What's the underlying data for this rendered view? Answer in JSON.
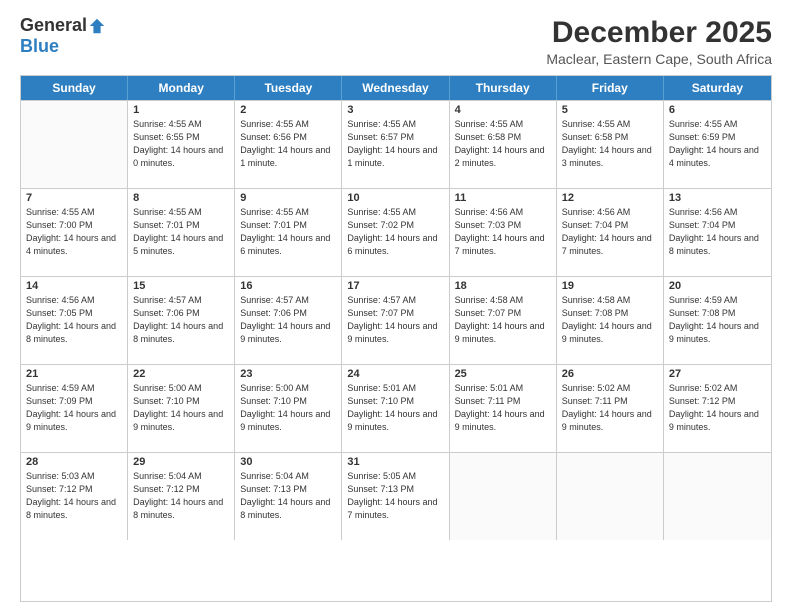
{
  "logo": {
    "general": "General",
    "blue": "Blue"
  },
  "header": {
    "title": "December 2025",
    "subtitle": "Maclear, Eastern Cape, South Africa"
  },
  "weekdays": [
    "Sunday",
    "Monday",
    "Tuesday",
    "Wednesday",
    "Thursday",
    "Friday",
    "Saturday"
  ],
  "weeks": [
    [
      {
        "day": "",
        "sunrise": "",
        "sunset": "",
        "daylight": ""
      },
      {
        "day": "1",
        "sunrise": "Sunrise: 4:55 AM",
        "sunset": "Sunset: 6:55 PM",
        "daylight": "Daylight: 14 hours and 0 minutes."
      },
      {
        "day": "2",
        "sunrise": "Sunrise: 4:55 AM",
        "sunset": "Sunset: 6:56 PM",
        "daylight": "Daylight: 14 hours and 1 minute."
      },
      {
        "day": "3",
        "sunrise": "Sunrise: 4:55 AM",
        "sunset": "Sunset: 6:57 PM",
        "daylight": "Daylight: 14 hours and 1 minute."
      },
      {
        "day": "4",
        "sunrise": "Sunrise: 4:55 AM",
        "sunset": "Sunset: 6:58 PM",
        "daylight": "Daylight: 14 hours and 2 minutes."
      },
      {
        "day": "5",
        "sunrise": "Sunrise: 4:55 AM",
        "sunset": "Sunset: 6:58 PM",
        "daylight": "Daylight: 14 hours and 3 minutes."
      },
      {
        "day": "6",
        "sunrise": "Sunrise: 4:55 AM",
        "sunset": "Sunset: 6:59 PM",
        "daylight": "Daylight: 14 hours and 4 minutes."
      }
    ],
    [
      {
        "day": "7",
        "sunrise": "Sunrise: 4:55 AM",
        "sunset": "Sunset: 7:00 PM",
        "daylight": "Daylight: 14 hours and 4 minutes."
      },
      {
        "day": "8",
        "sunrise": "Sunrise: 4:55 AM",
        "sunset": "Sunset: 7:01 PM",
        "daylight": "Daylight: 14 hours and 5 minutes."
      },
      {
        "day": "9",
        "sunrise": "Sunrise: 4:55 AM",
        "sunset": "Sunset: 7:01 PM",
        "daylight": "Daylight: 14 hours and 6 minutes."
      },
      {
        "day": "10",
        "sunrise": "Sunrise: 4:55 AM",
        "sunset": "Sunset: 7:02 PM",
        "daylight": "Daylight: 14 hours and 6 minutes."
      },
      {
        "day": "11",
        "sunrise": "Sunrise: 4:56 AM",
        "sunset": "Sunset: 7:03 PM",
        "daylight": "Daylight: 14 hours and 7 minutes."
      },
      {
        "day": "12",
        "sunrise": "Sunrise: 4:56 AM",
        "sunset": "Sunset: 7:04 PM",
        "daylight": "Daylight: 14 hours and 7 minutes."
      },
      {
        "day": "13",
        "sunrise": "Sunrise: 4:56 AM",
        "sunset": "Sunset: 7:04 PM",
        "daylight": "Daylight: 14 hours and 8 minutes."
      }
    ],
    [
      {
        "day": "14",
        "sunrise": "Sunrise: 4:56 AM",
        "sunset": "Sunset: 7:05 PM",
        "daylight": "Daylight: 14 hours and 8 minutes."
      },
      {
        "day": "15",
        "sunrise": "Sunrise: 4:57 AM",
        "sunset": "Sunset: 7:06 PM",
        "daylight": "Daylight: 14 hours and 8 minutes."
      },
      {
        "day": "16",
        "sunrise": "Sunrise: 4:57 AM",
        "sunset": "Sunset: 7:06 PM",
        "daylight": "Daylight: 14 hours and 9 minutes."
      },
      {
        "day": "17",
        "sunrise": "Sunrise: 4:57 AM",
        "sunset": "Sunset: 7:07 PM",
        "daylight": "Daylight: 14 hours and 9 minutes."
      },
      {
        "day": "18",
        "sunrise": "Sunrise: 4:58 AM",
        "sunset": "Sunset: 7:07 PM",
        "daylight": "Daylight: 14 hours and 9 minutes."
      },
      {
        "day": "19",
        "sunrise": "Sunrise: 4:58 AM",
        "sunset": "Sunset: 7:08 PM",
        "daylight": "Daylight: 14 hours and 9 minutes."
      },
      {
        "day": "20",
        "sunrise": "Sunrise: 4:59 AM",
        "sunset": "Sunset: 7:08 PM",
        "daylight": "Daylight: 14 hours and 9 minutes."
      }
    ],
    [
      {
        "day": "21",
        "sunrise": "Sunrise: 4:59 AM",
        "sunset": "Sunset: 7:09 PM",
        "daylight": "Daylight: 14 hours and 9 minutes."
      },
      {
        "day": "22",
        "sunrise": "Sunrise: 5:00 AM",
        "sunset": "Sunset: 7:10 PM",
        "daylight": "Daylight: 14 hours and 9 minutes."
      },
      {
        "day": "23",
        "sunrise": "Sunrise: 5:00 AM",
        "sunset": "Sunset: 7:10 PM",
        "daylight": "Daylight: 14 hours and 9 minutes."
      },
      {
        "day": "24",
        "sunrise": "Sunrise: 5:01 AM",
        "sunset": "Sunset: 7:10 PM",
        "daylight": "Daylight: 14 hours and 9 minutes."
      },
      {
        "day": "25",
        "sunrise": "Sunrise: 5:01 AM",
        "sunset": "Sunset: 7:11 PM",
        "daylight": "Daylight: 14 hours and 9 minutes."
      },
      {
        "day": "26",
        "sunrise": "Sunrise: 5:02 AM",
        "sunset": "Sunset: 7:11 PM",
        "daylight": "Daylight: 14 hours and 9 minutes."
      },
      {
        "day": "27",
        "sunrise": "Sunrise: 5:02 AM",
        "sunset": "Sunset: 7:12 PM",
        "daylight": "Daylight: 14 hours and 9 minutes."
      }
    ],
    [
      {
        "day": "28",
        "sunrise": "Sunrise: 5:03 AM",
        "sunset": "Sunset: 7:12 PM",
        "daylight": "Daylight: 14 hours and 8 minutes."
      },
      {
        "day": "29",
        "sunrise": "Sunrise: 5:04 AM",
        "sunset": "Sunset: 7:12 PM",
        "daylight": "Daylight: 14 hours and 8 minutes."
      },
      {
        "day": "30",
        "sunrise": "Sunrise: 5:04 AM",
        "sunset": "Sunset: 7:13 PM",
        "daylight": "Daylight: 14 hours and 8 minutes."
      },
      {
        "day": "31",
        "sunrise": "Sunrise: 5:05 AM",
        "sunset": "Sunset: 7:13 PM",
        "daylight": "Daylight: 14 hours and 7 minutes."
      },
      {
        "day": "",
        "sunrise": "",
        "sunset": "",
        "daylight": ""
      },
      {
        "day": "",
        "sunrise": "",
        "sunset": "",
        "daylight": ""
      },
      {
        "day": "",
        "sunrise": "",
        "sunset": "",
        "daylight": ""
      }
    ]
  ]
}
